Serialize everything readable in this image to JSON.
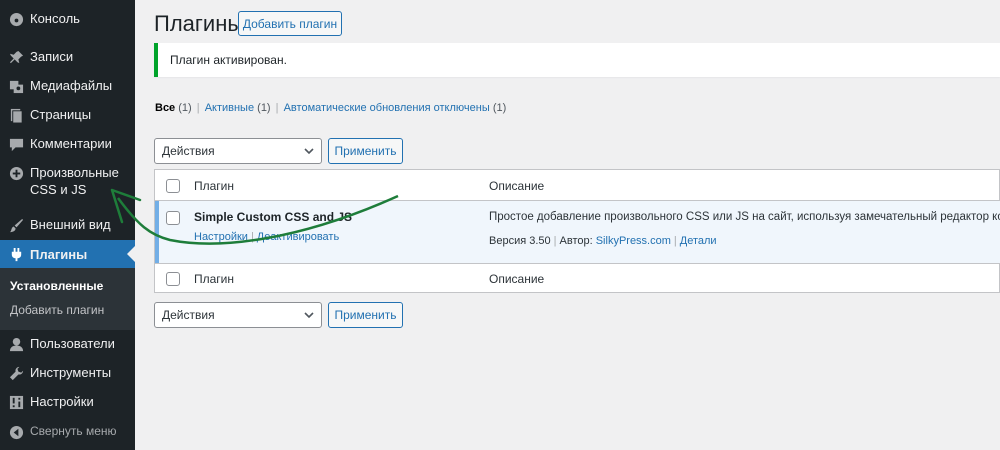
{
  "sidebar": {
    "items": [
      {
        "label": "Консоль",
        "icon": "dashboard-icon"
      },
      {
        "label": "Записи",
        "icon": "pin-icon"
      },
      {
        "label": "Медиафайлы",
        "icon": "media-icon"
      },
      {
        "label": "Страницы",
        "icon": "page-icon"
      },
      {
        "label": "Комментарии",
        "icon": "comment-icon"
      },
      {
        "label": "Произвольные CSS и JS",
        "icon": "plus-circle-icon"
      },
      {
        "label": "Внешний вид",
        "icon": "brush-icon"
      },
      {
        "label": "Плагины",
        "icon": "plugin-icon"
      },
      {
        "label": "Пользователи",
        "icon": "user-icon"
      },
      {
        "label": "Инструменты",
        "icon": "wrench-icon"
      },
      {
        "label": "Настройки",
        "icon": "settings-icon"
      }
    ],
    "submenu": [
      "Установленные",
      "Добавить плагин"
    ],
    "collapse_label": "Свернуть меню"
  },
  "header": {
    "title": "Плагины",
    "add_button": "Добавить плагин"
  },
  "notice": "Плагин активирован.",
  "filters": {
    "all": "Все",
    "all_count": "(1)",
    "active": "Активные",
    "active_count": "(1)",
    "auto": "Автоматические обновления отключены",
    "auto_count": "(1)"
  },
  "bulk": {
    "select_value": "Действия",
    "apply_label": "Применить"
  },
  "table": {
    "col_plugin": "Плагин",
    "col_desc": "Описание",
    "plugin": {
      "name": "Simple Custom CSS and JS",
      "action_settings": "Настройки",
      "action_deactivate": "Деактивировать",
      "description": "Простое добавление произвольного CSS или JS на сайт, используя замечательный редактор кода.",
      "version": "Версия 3.50",
      "author_label": "Автор:",
      "author": "SilkyPress.com",
      "details": "Детали"
    }
  },
  "colors": {
    "sidebar_bg": "#1d2327",
    "accent": "#2271b1",
    "success": "#00a32a",
    "annotation_arrow": "#1e7d3a"
  }
}
